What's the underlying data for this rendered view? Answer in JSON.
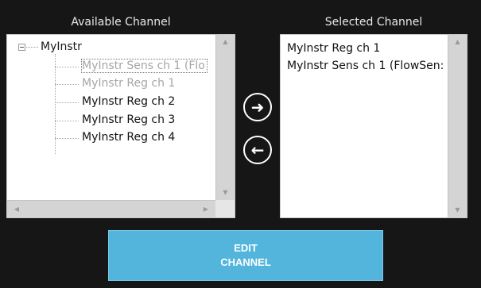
{
  "available": {
    "title": "Available Channel",
    "root_label": "MyInstr",
    "items": [
      {
        "label": "MyInstr Sens ch 1 (Flo",
        "state": "disabled"
      },
      {
        "label": "MyInstr Reg ch 1",
        "state": "disabled"
      },
      {
        "label": "MyInstr Reg ch 2",
        "state": "enabled"
      },
      {
        "label": "MyInstr Reg ch 3",
        "state": "enabled"
      },
      {
        "label": "MyInstr Reg ch 4",
        "state": "enabled"
      }
    ]
  },
  "selected": {
    "title": "Selected Channel",
    "items": [
      {
        "label": "MyInstr Reg ch 1"
      },
      {
        "label": "MyInstr Sens ch 1 (FlowSen:"
      }
    ]
  },
  "buttons": {
    "add_icon": "arrow-right-circle-icon",
    "add_glyph": "➜",
    "remove_icon": "arrow-left-circle-icon",
    "remove_glyph": "←",
    "edit_line1": "EDIT",
    "edit_line2": "CHANNEL"
  },
  "colors": {
    "background": "#161616",
    "edit_button": "#53b5dc",
    "disabled_text": "#a6a6a6"
  }
}
